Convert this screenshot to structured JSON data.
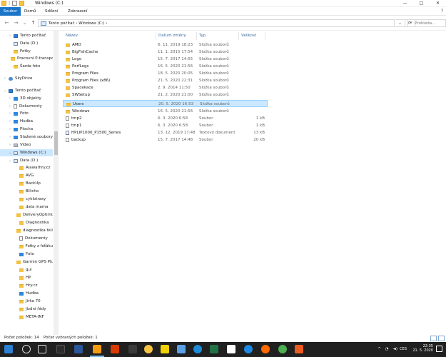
{
  "window": {
    "title": "Windows (C:)",
    "minimize_icon": "—",
    "maximize_icon": "□",
    "close_icon": "✕",
    "quick_sep": "|"
  },
  "ribbon": {
    "tabs": [
      "Soubor",
      "Domů",
      "Sdílení",
      "Zobrazení"
    ],
    "help_icon": "?"
  },
  "address": {
    "back_icon": "←",
    "forward_icon": "→",
    "recent_icon": "⌄",
    "up_icon": "↑",
    "path": "Tento počítač  ›  Windows (C:)  ›",
    "dropdown_icon": "⌄",
    "refresh_icon": "⟳",
    "search_placeholder": "Prohleda..."
  },
  "nav": {
    "items": [
      {
        "label": "Tento počítač",
        "icon": "pc-icon",
        "chevron": "›"
      },
      {
        "label": "Data (D:)",
        "icon": "drive-icon",
        "chevron": ""
      },
      {
        "label": "Fotky",
        "icon": "folder-icon",
        "chevron": ""
      },
      {
        "label": "Pracovní P-transpo",
        "icon": "folder-icon",
        "chevron": ""
      },
      {
        "label": "Šarda foto",
        "icon": "folder-icon",
        "chevron": ""
      },
      {
        "label": "SkyDrive",
        "icon": "cloud-icon",
        "chevron": "›"
      },
      {
        "label": "Tento počítač",
        "icon": "pc-icon",
        "chevron": "⌄"
      },
      {
        "label": "3D objekty",
        "icon": "blue-icon",
        "chevron": "›"
      },
      {
        "label": "Dokumenty",
        "icon": "file-icon",
        "chevron": "›"
      },
      {
        "label": "Foto",
        "icon": "blue-icon",
        "chevron": "›"
      },
      {
        "label": "Hudba",
        "icon": "blue-icon",
        "chevron": "›"
      },
      {
        "label": "Plocha",
        "icon": "blue-icon",
        "chevron": "›"
      },
      {
        "label": "Stažené soubory",
        "icon": "blue-icon",
        "chevron": "›"
      },
      {
        "label": "Video",
        "icon": "gray-icon",
        "chevron": "›"
      },
      {
        "label": "Windows (C:)",
        "icon": "drive-icon",
        "chevron": "⌄"
      },
      {
        "label": "Data (D:)",
        "icon": "drive-icon",
        "chevron": "⌄"
      },
      {
        "label": "Alawarhry.cz",
        "icon": "folder-icon",
        "chevron": ""
      },
      {
        "label": "AVG",
        "icon": "folder-icon",
        "chevron": ""
      },
      {
        "label": "BackUp",
        "icon": "folder-icon",
        "chevron": ""
      },
      {
        "label": "Bilicho",
        "icon": "folder-icon",
        "chevron": ""
      },
      {
        "label": "cyklotrasy",
        "icon": "folder-icon",
        "chevron": ""
      },
      {
        "label": "data mama",
        "icon": "folder-icon",
        "chevron": ""
      },
      {
        "label": "DeliveryOptimizat",
        "icon": "folder-icon",
        "chevron": ""
      },
      {
        "label": "Diagnostika",
        "icon": "folder-icon",
        "chevron": ""
      },
      {
        "label": "diagnostika felicie",
        "icon": "folder-icon",
        "chevron": ""
      },
      {
        "label": "Dokumenty",
        "icon": "file-icon",
        "chevron": ""
      },
      {
        "label": "Fotky z foťáku",
        "icon": "folder-icon",
        "chevron": ""
      },
      {
        "label": "Foto",
        "icon": "blue-icon",
        "chevron": ""
      },
      {
        "label": "Garmin GPS Plugi",
        "icon": "folder-icon",
        "chevron": ""
      },
      {
        "label": "gui",
        "icon": "folder-icon",
        "chevron": ""
      },
      {
        "label": "HP",
        "icon": "folder-icon",
        "chevron": ""
      },
      {
        "label": "Hry.cz",
        "icon": "folder-icon",
        "chevron": ""
      },
      {
        "label": "Hudba",
        "icon": "blue-icon",
        "chevron": ""
      },
      {
        "label": "Jirka 70",
        "icon": "folder-icon",
        "chevron": ""
      },
      {
        "label": "Jízdní řády",
        "icon": "folder-icon",
        "chevron": ""
      },
      {
        "label": "META-INF",
        "icon": "folder-icon",
        "chevron": ""
      }
    ]
  },
  "columns": {
    "name": "Název",
    "date": "Datum změny",
    "type": "Typ",
    "size": "Velikost"
  },
  "files": [
    {
      "name": "AMD",
      "date": "6. 11. 2019 18:23",
      "type": "Složka souborů",
      "size": "",
      "icon": "folder-icon"
    },
    {
      "name": "BigFishCache",
      "date": "11. 1. 2015 17:54",
      "type": "Složka souborů",
      "size": "",
      "icon": "folder-icon"
    },
    {
      "name": "Logo",
      "date": "15. 7. 2017 14:55",
      "type": "Složka souborů",
      "size": "",
      "icon": "folder-icon"
    },
    {
      "name": "PerfLogs",
      "date": "16. 5. 2020 21:56",
      "type": "Složka souborů",
      "size": "",
      "icon": "folder-icon"
    },
    {
      "name": "Program Files",
      "date": "18. 5. 2020 20:05",
      "type": "Složka souborů",
      "size": "",
      "icon": "folder-icon"
    },
    {
      "name": "Program Files (x86)",
      "date": "21. 5. 2020 22:31",
      "type": "Složka souborů",
      "size": "",
      "icon": "folder-icon"
    },
    {
      "name": "Spacekace",
      "date": "2. 9. 2014 11:50",
      "type": "Složka souborů",
      "size": "",
      "icon": "folder-icon"
    },
    {
      "name": "SWSetup",
      "date": "21. 2. 2020 21:00",
      "type": "Složka souborů",
      "size": "",
      "icon": "folder-icon"
    },
    {
      "name": "Users",
      "date": "20. 5. 2020 16:53",
      "type": "Složka souborů",
      "size": "",
      "icon": "folder-icon",
      "selected": true
    },
    {
      "name": "Windows",
      "date": "16. 5. 2020 21:56",
      "type": "Složka souborů",
      "size": "",
      "icon": "folder-icon"
    },
    {
      "name": "tmp2",
      "date": "6. 3. 2020 6:58",
      "type": "Soubor",
      "size": "1 kB",
      "icon": "file-icon"
    },
    {
      "name": "tmp1",
      "date": "6. 3. 2020 6:58",
      "type": "Soubor",
      "size": "1 kB",
      "icon": "file-icon"
    },
    {
      "name": "HPLIP1000_P1500_Series",
      "date": "13. 12. 2019 17:48",
      "type": "Textový dokument",
      "size": "13 kB",
      "icon": "text-icon"
    },
    {
      "name": "backup",
      "date": "15. 7. 2017 14:48",
      "type": "Soubor",
      "size": "20 kB",
      "icon": "file-icon"
    }
  ],
  "status": {
    "items_count": "Počet položek: 14",
    "selected_count": "Počet vybraných položek: 1"
  },
  "taskbar": {
    "language": "CES",
    "tray_up_icon": "^",
    "network_icon": "◔",
    "volume_icon": "◄)",
    "time": "22:35",
    "date": "21. 5. 2020"
  },
  "colors": {
    "accent": "#1a75c9",
    "selection": "#cce8ff",
    "taskbar": "#202020",
    "folder": "#f5c242"
  }
}
